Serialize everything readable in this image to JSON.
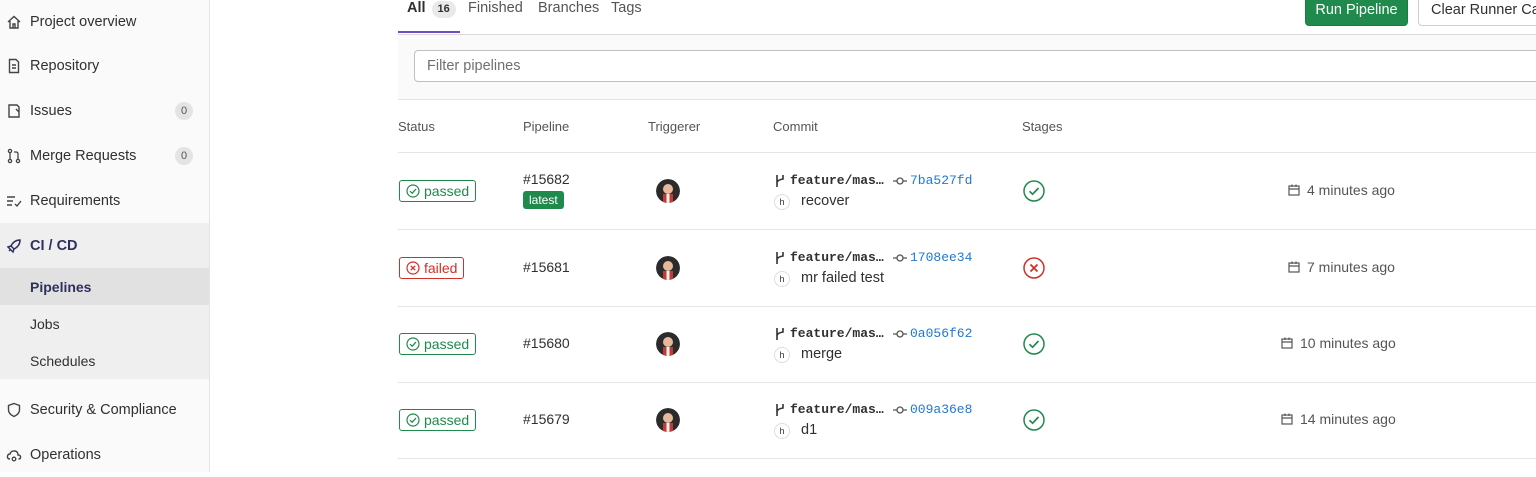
{
  "sidebar": {
    "items": [
      {
        "label": "Project overview",
        "icon": "home-icon"
      },
      {
        "label": "Repository",
        "icon": "document-icon"
      },
      {
        "label": "Issues",
        "icon": "issues-icon",
        "count": "0"
      },
      {
        "label": "Merge Requests",
        "icon": "merge-request-icon",
        "count": "0"
      },
      {
        "label": "Requirements",
        "icon": "requirements-icon"
      },
      {
        "label": "CI / CD",
        "icon": "rocket-icon"
      },
      {
        "label": "Security & Compliance",
        "icon": "shield-icon"
      },
      {
        "label": "Operations",
        "icon": "cloud-gear-icon"
      }
    ],
    "cicd_sub": [
      {
        "label": "Pipelines"
      },
      {
        "label": "Jobs"
      },
      {
        "label": "Schedules"
      }
    ]
  },
  "tabs": {
    "all": "All",
    "all_count": "16",
    "finished": "Finished",
    "branches": "Branches",
    "tags": "Tags"
  },
  "actions": {
    "run_pipeline": "Run Pipeline",
    "clear_cache": "Clear Runner Caches"
  },
  "filter": {
    "placeholder": "Filter pipelines"
  },
  "table": {
    "headers": [
      "Status",
      "Pipeline",
      "Triggerer",
      "Commit",
      "Stages"
    ],
    "rows": [
      {
        "status": "passed",
        "pipeline": "#15682",
        "badge": "latest",
        "branch": "feature/mas…",
        "sha": "7ba527fd",
        "message": "recover",
        "stage": "passed",
        "time": "4 minutes ago"
      },
      {
        "status": "failed",
        "pipeline": "#15681",
        "badge": "",
        "branch": "feature/mas…",
        "sha": "1708ee34",
        "message": "mr failed test",
        "stage": "failed",
        "time": "7 minutes ago"
      },
      {
        "status": "passed",
        "pipeline": "#15680",
        "badge": "",
        "branch": "feature/mas…",
        "sha": "0a056f62",
        "message": "merge",
        "stage": "passed",
        "time": "10 minutes ago"
      },
      {
        "status": "passed",
        "pipeline": "#15679",
        "badge": "",
        "branch": "feature/mas…",
        "sha": "009a36e8",
        "message": "d1",
        "stage": "passed",
        "time": "14 minutes ago"
      }
    ],
    "commit_author_initials": "h"
  },
  "colors": {
    "success": "#1f8a4c",
    "danger": "#d22f27",
    "link": "#1f78d1",
    "active_tab": "#6b4fbb"
  }
}
